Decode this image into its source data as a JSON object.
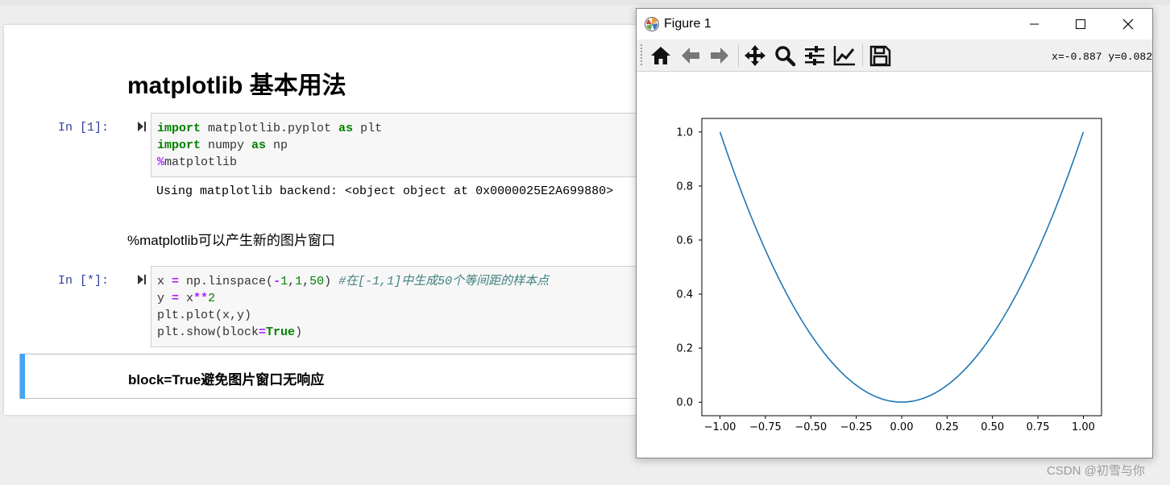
{
  "notebook": {
    "title": "matplotlib 基本用法",
    "cells": [
      {
        "prompt": "In  [1]:",
        "code_lines": [
          [
            {
              "t": "import",
              "c": "kw"
            },
            {
              "t": " matplotlib.pyplot "
            },
            {
              "t": "as",
              "c": "kw"
            },
            {
              "t": " plt"
            }
          ],
          [
            {
              "t": "import",
              "c": "kw"
            },
            {
              "t": " numpy "
            },
            {
              "t": "as",
              "c": "kw"
            },
            {
              "t": " np"
            }
          ],
          [
            {
              "t": "%",
              "c": "op"
            },
            {
              "t": "matplotlib"
            }
          ]
        ],
        "output": "Using matplotlib backend: <object object at 0x0000025E2A699880>"
      },
      {
        "markdown": "%matplotlib可以产生新的图片窗口"
      },
      {
        "prompt": "In  [*]:",
        "code_lines": [
          [
            {
              "t": "x "
            },
            {
              "t": "=",
              "c": "op"
            },
            {
              "t": " np.linspace("
            },
            {
              "t": "-",
              "c": "op"
            },
            {
              "t": "1",
              "c": "num"
            },
            {
              "t": ","
            },
            {
              "t": "1",
              "c": "num"
            },
            {
              "t": ","
            },
            {
              "t": "50",
              "c": "num"
            },
            {
              "t": ") "
            },
            {
              "t": "#在[-1,1]中生成50个等间距的样本点",
              "c": "cm"
            }
          ],
          [
            {
              "t": "y "
            },
            {
              "t": "=",
              "c": "op"
            },
            {
              "t": " x"
            },
            {
              "t": "**",
              "c": "op"
            },
            {
              "t": "2",
              "c": "num"
            }
          ],
          [
            {
              "t": "plt.plot(x,y)"
            }
          ],
          [
            {
              "t": "plt.show(block"
            },
            {
              "t": "=",
              "c": "op"
            },
            {
              "t": "True",
              "c": "kw"
            },
            {
              "t": ")"
            }
          ]
        ]
      },
      {
        "markdown_bold": "block=True避免图片窗口无响应"
      }
    ]
  },
  "figure_window": {
    "title": "Figure 1",
    "controls": {
      "minimize": "minimize-icon",
      "maximize": "maximize-icon",
      "close": "close-icon"
    },
    "toolbar": [
      {
        "name": "home-icon"
      },
      {
        "name": "back-arrow-icon"
      },
      {
        "name": "forward-arrow-icon"
      },
      {
        "name": "pan-move-icon"
      },
      {
        "name": "zoom-magnifier-icon"
      },
      {
        "name": "subplots-configure-icon"
      },
      {
        "name": "edit-axis-icon"
      },
      {
        "name": "save-disk-icon"
      }
    ],
    "coords_readout": "x=-0.887 y=0.082"
  },
  "chart_data": {
    "type": "line",
    "title": "",
    "xlabel": "",
    "ylabel": "",
    "xlim": [
      -1.1,
      1.1
    ],
    "ylim": [
      -0.05,
      1.05
    ],
    "xticks": [
      -1.0,
      -0.75,
      -0.5,
      -0.25,
      0.0,
      0.25,
      0.5,
      0.75,
      1.0
    ],
    "xtick_labels": [
      "−1.00",
      "−0.75",
      "−0.50",
      "−0.25",
      "0.00",
      "0.25",
      "0.50",
      "0.75",
      "1.00"
    ],
    "yticks": [
      0.0,
      0.2,
      0.4,
      0.6,
      0.8,
      1.0
    ],
    "ytick_labels": [
      "0.0",
      "0.2",
      "0.4",
      "0.6",
      "0.8",
      "1.0"
    ],
    "series": [
      {
        "expression": "y = x**2",
        "x_range": [
          -1,
          1
        ],
        "points": 50,
        "color": "#1f77b4"
      }
    ],
    "grid": false,
    "legend": "none"
  },
  "watermark": "CSDN @初雪与你"
}
